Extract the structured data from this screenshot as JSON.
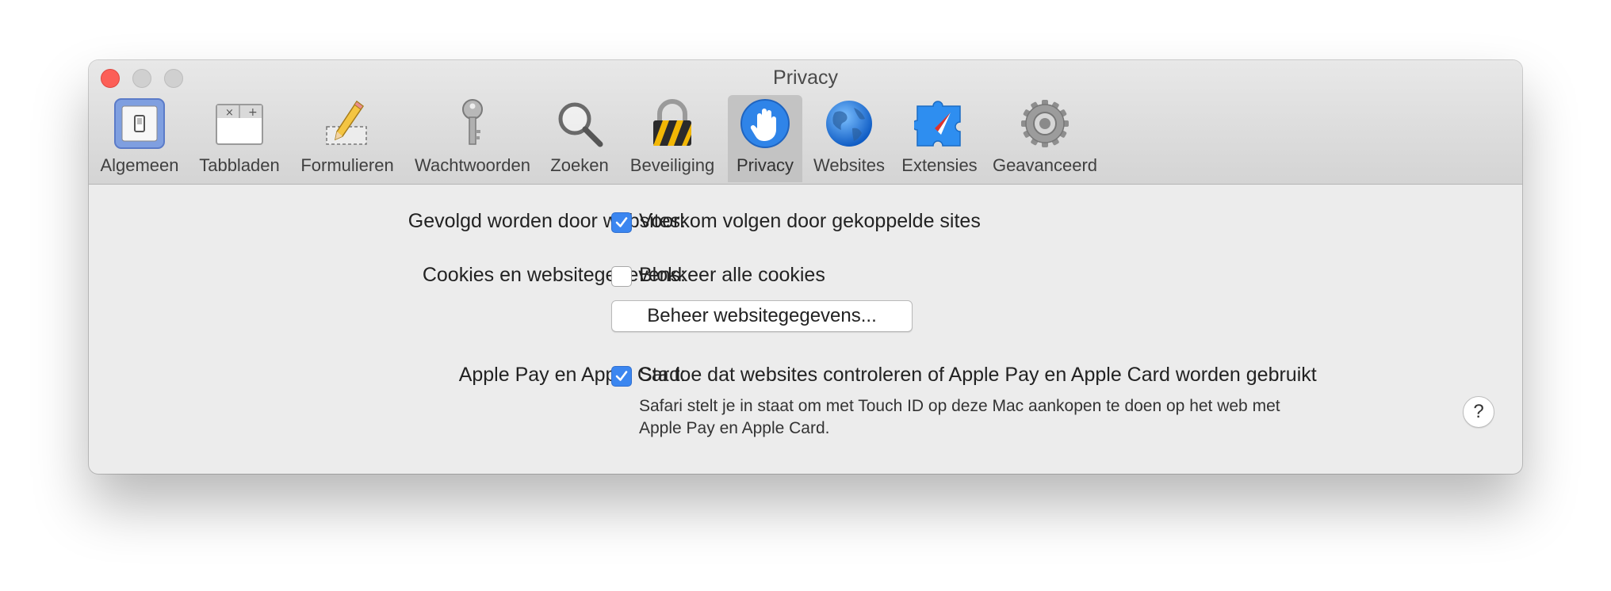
{
  "window": {
    "title": "Privacy"
  },
  "toolbar": {
    "items": [
      {
        "label": "Algemeen",
        "icon": "general-switch-icon"
      },
      {
        "label": "Tabbladen",
        "icon": "tabs-icon"
      },
      {
        "label": "Formulieren",
        "icon": "pencil-form-icon"
      },
      {
        "label": "Wachtwoorden",
        "icon": "key-icon"
      },
      {
        "label": "Zoeken",
        "icon": "magnifier-icon"
      },
      {
        "label": "Beveiliging",
        "icon": "padlock-icon"
      },
      {
        "label": "Privacy",
        "icon": "privacy-hand-icon",
        "selected": true
      },
      {
        "label": "Websites",
        "icon": "globe-icon"
      },
      {
        "label": "Extensies",
        "icon": "extensions-puzzle-icon"
      },
      {
        "label": "Geavanceerd",
        "icon": "gear-icon"
      }
    ]
  },
  "settings": {
    "tracking": {
      "label": "Gevolgd worden door websites:",
      "option": "Voorkom volgen door gekoppelde sites",
      "checked": true
    },
    "cookies": {
      "label": "Cookies en websitegegevens:",
      "option": "Blokkeer alle cookies",
      "checked": false,
      "button": "Beheer websitegegevens..."
    },
    "applepay": {
      "label": "Apple Pay en Apple Card:",
      "option": "Sta toe dat websites controleren of Apple Pay en Apple Card worden gebruikt",
      "checked": true,
      "description_line1": "Safari stelt je in staat om met Touch ID op deze Mac aankopen te doen op het web met",
      "description_line2": "Apple Pay en Apple Card."
    }
  },
  "help": {
    "label": "?"
  },
  "colors": {
    "accent": "#3b86f0",
    "close": "#fc5f57"
  }
}
